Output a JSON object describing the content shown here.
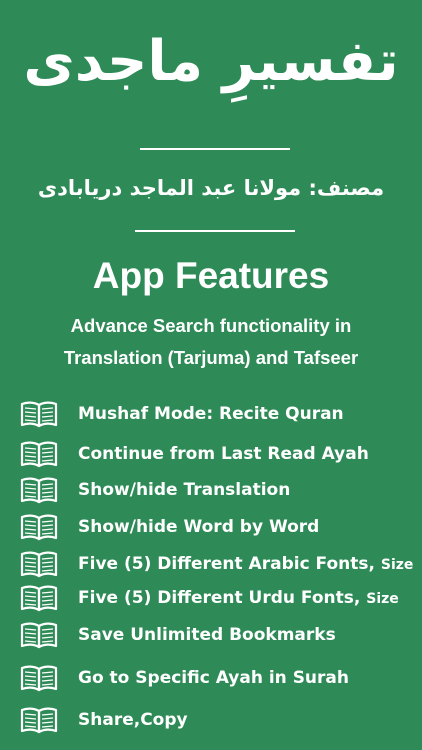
{
  "title_ar": "تفسیرِ ماجدی",
  "author_ar": "مصنف: مولانا عبد الماجد دریابادی",
  "heading": "App Features",
  "subheading_line1": "Advance Search functionality in",
  "subheading_line2": "Translation (Tarjuma) and Tafseer",
  "icons": {
    "feature": "open-book-icon"
  },
  "colors": {
    "background": "#2e8b57",
    "text": "#ffffff"
  },
  "features": [
    {
      "label": "Mushaf Mode: Recite Quran"
    },
    {
      "label": "Continue from Last Read Ayah"
    },
    {
      "label": "Show/hide Translation"
    },
    {
      "label": "Show/hide Word by Word"
    },
    {
      "label": "Five (5) Different Arabic Fonts,",
      "suffix": "Size"
    },
    {
      "label": "Five (5) Different Urdu Fonts,",
      "suffix": "Size"
    },
    {
      "label": "Save Unlimited Bookmarks"
    },
    {
      "label": "Go to Specific Ayah in Surah"
    },
    {
      "label": "Share,Copy"
    }
  ]
}
